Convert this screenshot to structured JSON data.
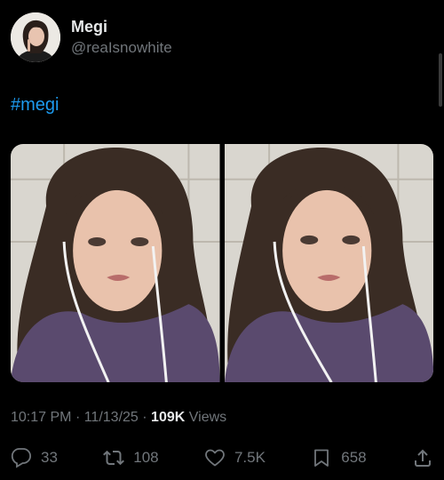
{
  "author": {
    "display_name": "Megi",
    "handle": "@reaIsnowhite"
  },
  "post": {
    "text": "#megi",
    "time": "10:17 PM",
    "separator": "·",
    "date": "11/13/25",
    "views_count": "109K",
    "views_label": "Views"
  },
  "media": {
    "count": 2
  },
  "actions": {
    "replies": "33",
    "reposts": "108",
    "likes": "7.5K",
    "bookmarks": "658"
  },
  "icons": [
    "reply-icon",
    "repost-icon",
    "like-icon",
    "bookmark-icon",
    "share-icon"
  ],
  "colors": {
    "background": "#000000",
    "text": "#e7e9ea",
    "muted": "#71767b",
    "link": "#1d9bf0"
  }
}
